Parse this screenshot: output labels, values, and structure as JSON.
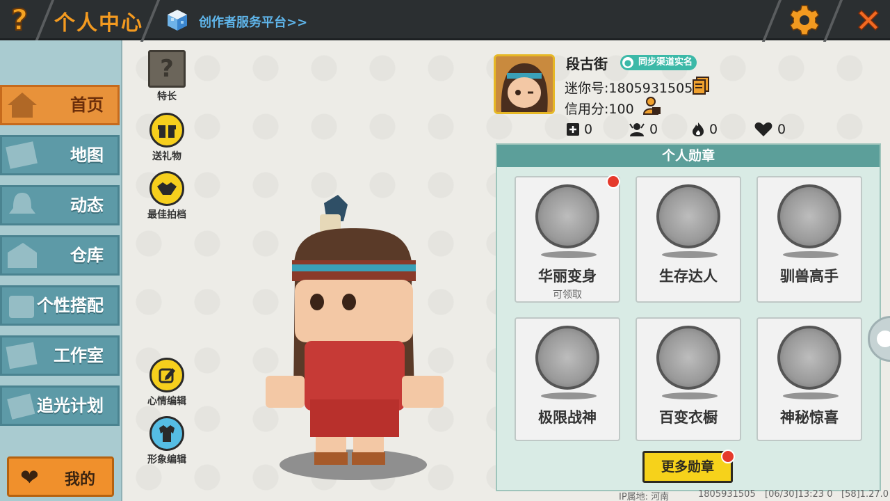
{
  "topbar": {
    "help_symbol": "?",
    "title": "个人中心",
    "creator_link": "创作者服务平台>>",
    "icons": {
      "help": "question-icon",
      "creator": "cube-icon",
      "settings": "gear-icon",
      "close": "close-icon"
    }
  },
  "sidebar": {
    "items": [
      {
        "label": "首页",
        "icon": "house-icon",
        "active": true
      },
      {
        "label": "地图",
        "icon": "map-icon",
        "active": false
      },
      {
        "label": "动态",
        "icon": "bell-icon",
        "active": false
      },
      {
        "label": "仓库",
        "icon": "warehouse-icon",
        "active": false
      },
      {
        "label": "个性搭配",
        "icon": "costume-icon",
        "active": false
      },
      {
        "label": "工作室",
        "icon": "studio-icon",
        "active": false
      },
      {
        "label": "追光计划",
        "icon": "plan-icon",
        "active": false
      }
    ],
    "my_button": "我的"
  },
  "actions": {
    "skill": "特长",
    "skill_symbol": "?",
    "gift": "送礼物",
    "partner": "最佳拍档",
    "mood_edit": "心情编辑",
    "image_edit": "形象编辑"
  },
  "profile": {
    "nickname": "段古街",
    "verify_badge": "同步渠道实名",
    "mini_id": "迷你号:1805931505",
    "credit": "信用分:100",
    "stats": {
      "plus": "0",
      "fans": "0",
      "fire": "0",
      "likes": "0"
    }
  },
  "medals": {
    "header": "个人勋章",
    "items": [
      {
        "name": "华丽变身",
        "sub": "可领取",
        "badge": true
      },
      {
        "name": "生存达人",
        "sub": "",
        "badge": false
      },
      {
        "name": "驯兽高手",
        "sub": "",
        "badge": false
      },
      {
        "name": "极限战神",
        "sub": "",
        "badge": false
      },
      {
        "name": "百变衣橱",
        "sub": "",
        "badge": false
      },
      {
        "name": "神秘惊喜",
        "sub": "",
        "badge": false
      }
    ],
    "more_button": "更多勋章"
  },
  "footer": {
    "ip": "IP属地: 河南",
    "uid": "1805931505",
    "time": "[06/30]13:23 0",
    "version": "[58]1.27.0"
  },
  "colors": {
    "accent_orange": "#f39a20",
    "sidebar_blue": "#5d9aa7",
    "panel_teal": "#5c9f9a",
    "yellow_button": "#f6d21b"
  }
}
